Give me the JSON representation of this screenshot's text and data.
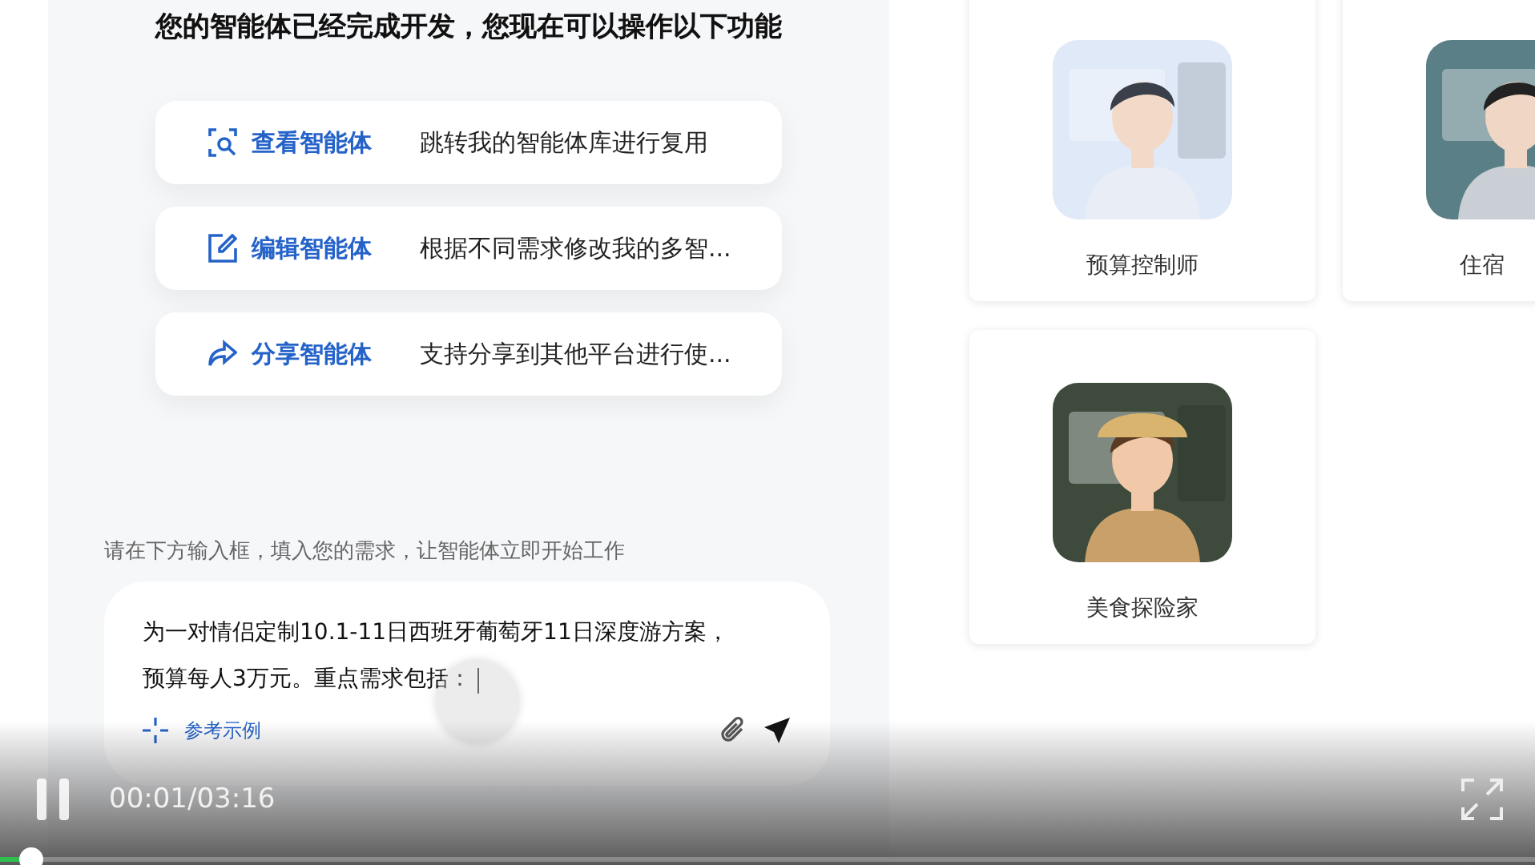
{
  "chat_panel": {
    "title": "您的智能体已经完成开发，您现在可以操作以下功能",
    "actions": [
      {
        "kind": "view",
        "label": "查看智能体",
        "description": "跳转我的智能体库进行复用"
      },
      {
        "kind": "edit",
        "label": "编辑智能体",
        "description": "根据不同需求修改我的多智..."
      },
      {
        "kind": "share",
        "label": "分享智能体",
        "description": "支持分享到其他平台进行使..."
      }
    ],
    "prompt": "请在下方输入框，填入您的需求，让智能体立即开始工作",
    "input": {
      "lines": [
        "为一对情侣定制10.1-11日西班牙葡萄牙11日深度游方案，",
        "预算每人3万元。重点需求包括："
      ],
      "example_link": "参考示例"
    }
  },
  "agents": [
    {
      "name": "预算控制师",
      "kind": "picture"
    },
    {
      "name": "住宿",
      "kind": "picture"
    },
    {
      "name": "美食探险家",
      "kind": "picture"
    }
  ],
  "player": {
    "playing": true,
    "time": "00:01/03:16",
    "level": 0.02
  }
}
